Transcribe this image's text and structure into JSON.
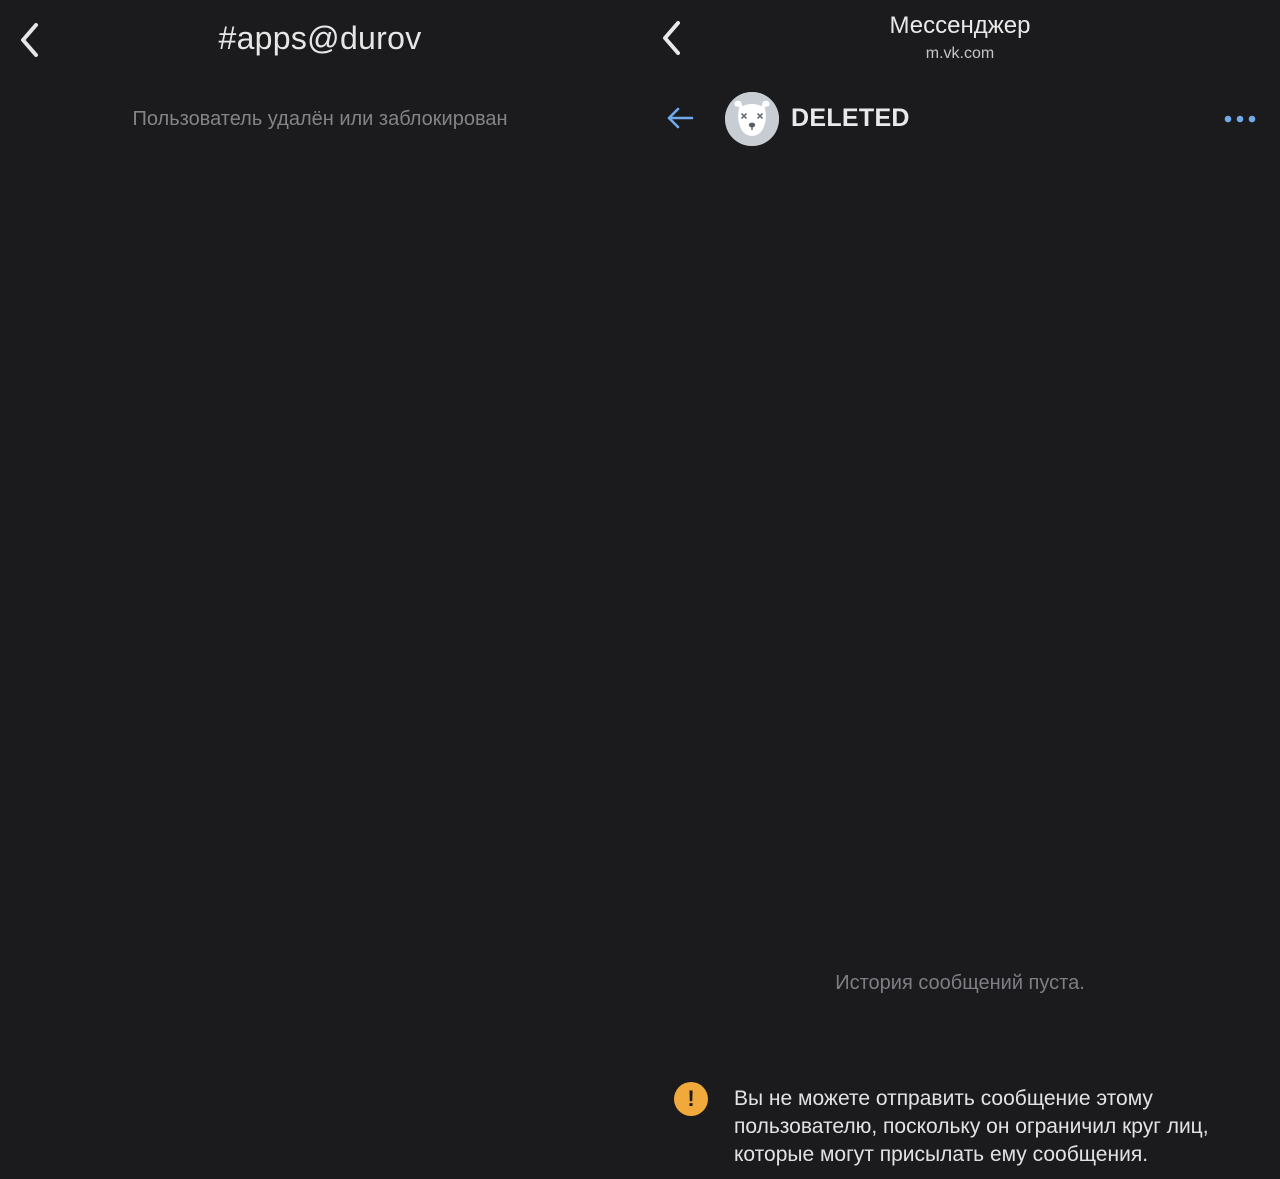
{
  "left": {
    "title": "#apps@durov",
    "status_text": "Пользователь удалён или заблокирован",
    "back_icon": "chevron-left-icon"
  },
  "right": {
    "header": {
      "title": "Мессенджер",
      "subtitle": "m.vk.com",
      "back_icon": "chevron-left-icon"
    },
    "chat": {
      "back_icon": "arrow-left-icon",
      "user_name": "DELETED",
      "avatar_icon": "deleted-dog-avatar",
      "more_icon": "more-dots-icon"
    },
    "empty_history": "История сообщений пуста.",
    "warning": {
      "icon": "exclamation-icon",
      "text": "Вы не можете отправить сообщение этому пользователю, поскольку он ограничил круг лиц, которые могут присылать ему сообщения."
    }
  },
  "colors": {
    "background": "#1b1b1d",
    "accent_blue": "#71aaeb",
    "warning_orange": "#f2a93b",
    "muted_text": "#838388"
  }
}
